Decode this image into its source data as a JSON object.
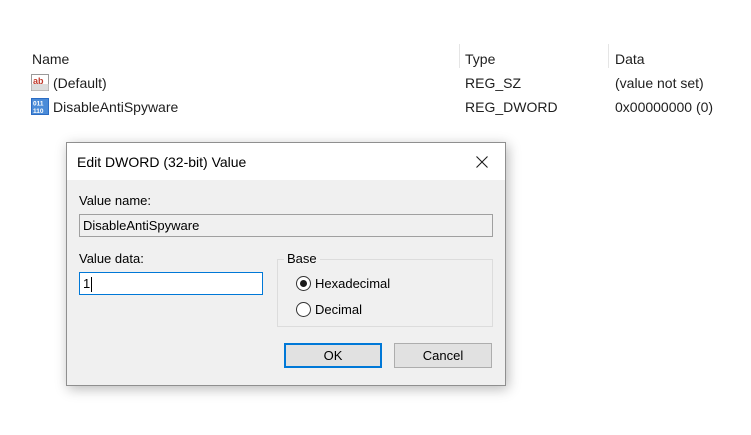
{
  "registry": {
    "columns": {
      "name": "Name",
      "type": "Type",
      "data": "Data"
    },
    "rows": [
      {
        "name": "(Default)",
        "type": "REG_SZ",
        "data": "(value not set)",
        "icon": "string-value-icon"
      },
      {
        "name": "DisableAntiSpyware",
        "type": "REG_DWORD",
        "data": "0x00000000 (0)",
        "icon": "dword-value-icon"
      }
    ]
  },
  "dialog": {
    "title": "Edit DWORD (32-bit) Value",
    "value_name_label": "Value name:",
    "value_name": "DisableAntiSpyware",
    "value_data_label": "Value data:",
    "value_data": "1",
    "base": {
      "label": "Base",
      "options": [
        "Hexadecimal",
        "Decimal"
      ],
      "selected": "Hexadecimal"
    },
    "ok_label": "OK",
    "cancel_label": "Cancel"
  },
  "colors": {
    "accent": "#0078d7",
    "string_icon": "#c0392b",
    "dword_icon": "#2b6cc4"
  }
}
